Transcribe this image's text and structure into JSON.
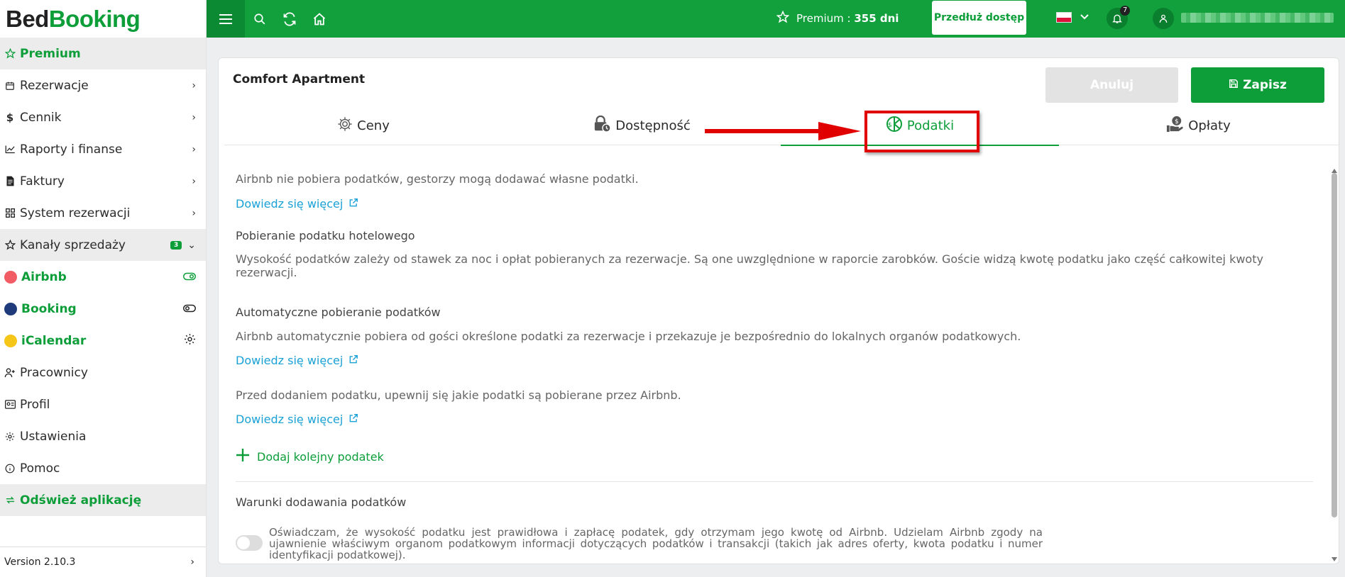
{
  "logo": {
    "part1": "Bed",
    "part2": "Booking"
  },
  "sidebar": {
    "items": [
      {
        "label": "Premium",
        "icon": "star-icon"
      },
      {
        "label": "Rezerwacje",
        "icon": "calendar-icon"
      },
      {
        "label": "Cennik",
        "icon": "dollar-icon"
      },
      {
        "label": "Raporty i finanse",
        "icon": "chart-icon"
      },
      {
        "label": "Faktury",
        "icon": "invoice-icon"
      },
      {
        "label": "System rezerwacji",
        "icon": "grid-icon"
      },
      {
        "label": "Kanały sprzedaży",
        "icon": "star-icon",
        "badge": "3"
      },
      {
        "label": "Airbnb",
        "color": "#f25c64"
      },
      {
        "label": "Booking",
        "color": "#1e3a7a"
      },
      {
        "label": "iCalendar",
        "color": "#f5c518"
      },
      {
        "label": "Pracownicy",
        "icon": "user-plus-icon"
      },
      {
        "label": "Profil",
        "icon": "profile-icon"
      },
      {
        "label": "Ustawienia",
        "icon": "gear-icon"
      },
      {
        "label": "Pomoc",
        "icon": "info-icon"
      },
      {
        "label": "Odśwież aplikację",
        "icon": "refresh-icon"
      }
    ],
    "version": "Version 2.10.3"
  },
  "topbar": {
    "premium_label": "Premium : ",
    "premium_days": "355 dni",
    "extend_label": "Przedłuż dostęp",
    "notifications": "7"
  },
  "card": {
    "title": "Comfort Apartment",
    "cancel": "Anuluj",
    "save": "Zapisz",
    "tabs": [
      "Ceny",
      "Dostępność",
      "Podatki",
      "Opłaty"
    ]
  },
  "content": {
    "intro": "Airbnb nie pobiera podatków, gestorzy mogą dodawać własne podatki.",
    "learn_more": "Dowiedz się więcej",
    "hotel_tax_heading": "Pobieranie podatku hotelowego",
    "hotel_tax_text": "Wysokość podatków zależy od stawek za noc i opłat pobieranych za rezerwacje. Są one uwzględnione w raporcie zarobków. Goście widzą kwotę podatku jako część całkowitej kwoty rezerwacji.",
    "auto_heading": "Automatyczne pobieranie podatków",
    "auto_text": "Airbnb automatycznie pobiera od gości określone podatki za rezerwacje i przekazuje je bezpośrednio do lokalnych organów podatkowych.",
    "before_text": "Przed dodaniem podatku, upewnij się jakie podatki są pobierane przez Airbnb.",
    "add_tax": "Dodaj kolejny podatek",
    "conditions_heading": "Warunki dodawania podatków",
    "declaration": "Oświadczam, że wysokość podatku jest prawidłowa i zapłacę podatek, gdy otrzymam jego kwotę od Airbnb. Udzielam Airbnb zgody na ujawnienie właściwym organom podatkowym informacji dotyczących podatków i transakcji (takich jak adres oferty, kwota podatku i numer identyfikacji podatkowej)."
  },
  "colors": {
    "brand": "#0d9e3a",
    "link": "#1aa1d6",
    "highlight": "#e10000"
  }
}
